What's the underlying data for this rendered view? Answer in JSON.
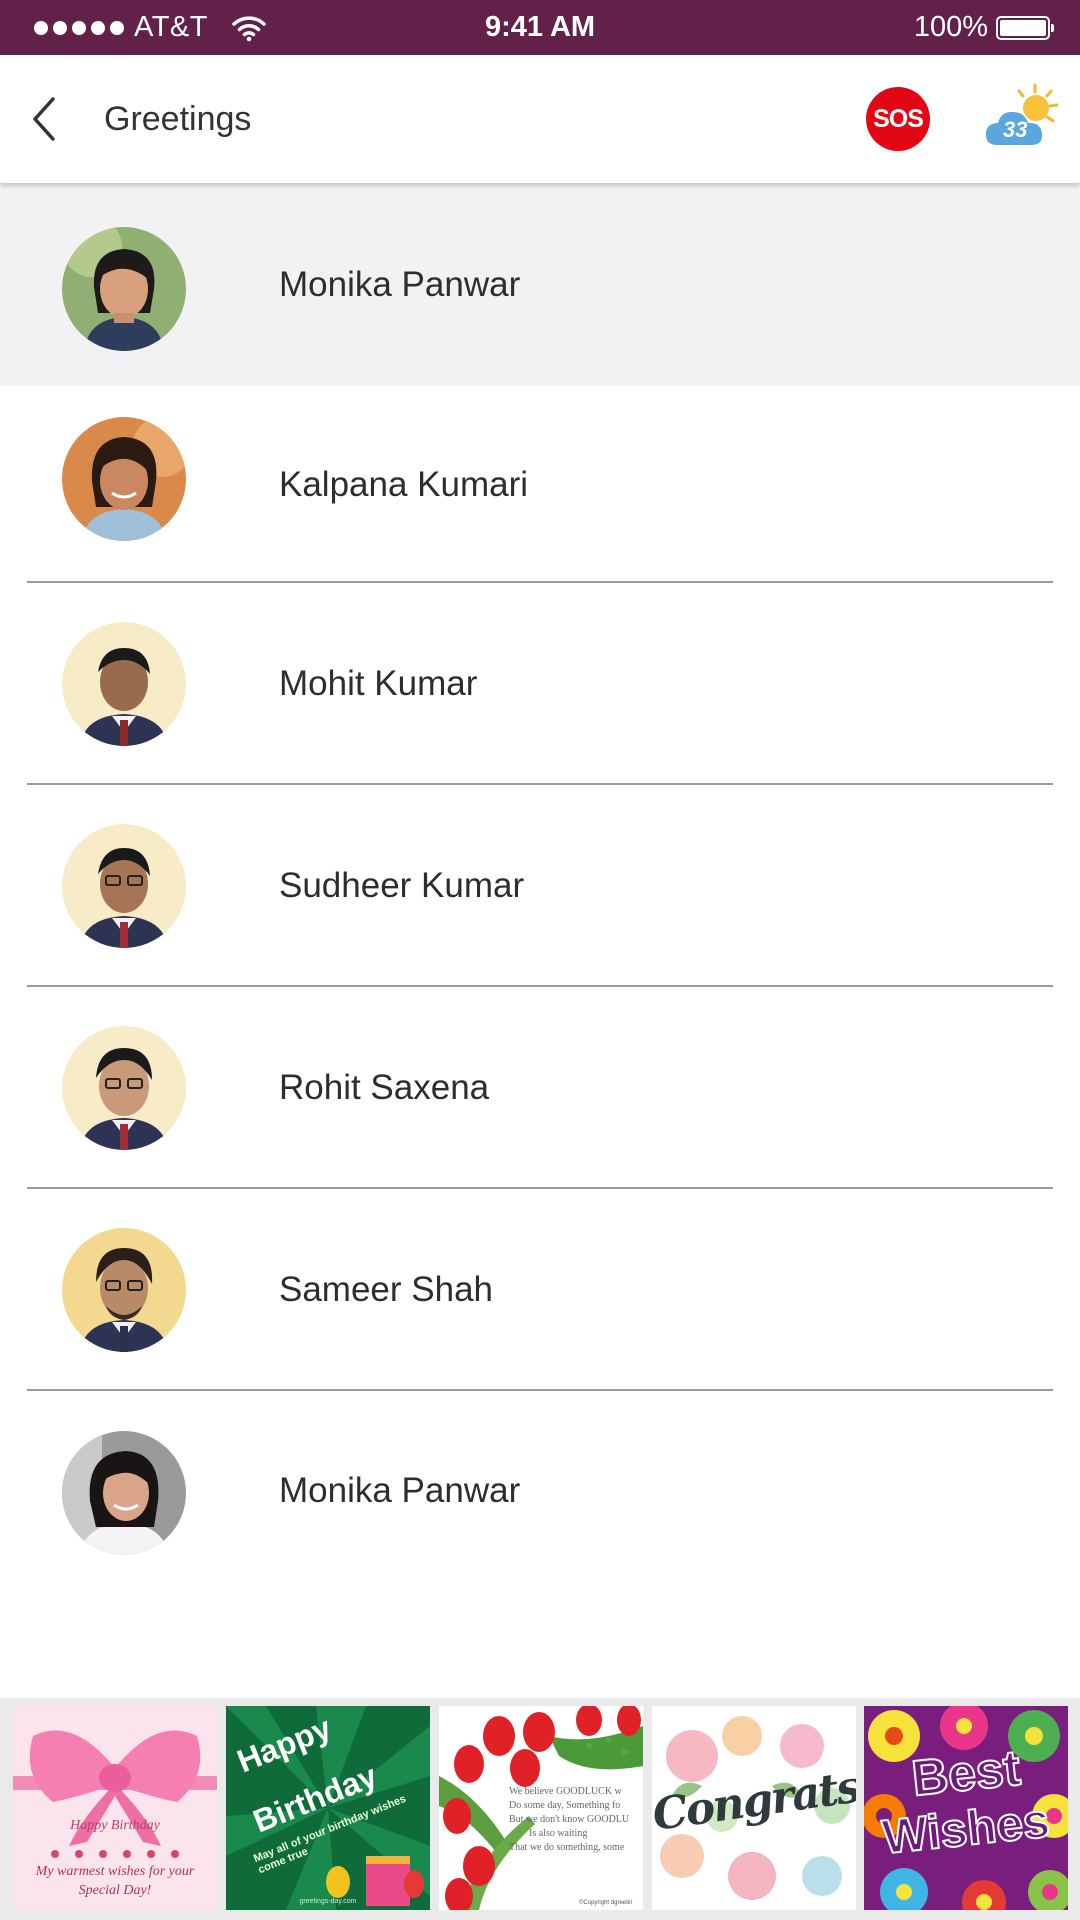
{
  "status_bar": {
    "carrier": "AT&T",
    "time": "9:41 AM",
    "battery": "100%"
  },
  "header": {
    "title": "Greetings",
    "sos_label": "SOS",
    "weather_temp": "33"
  },
  "contacts": [
    {
      "name": "Monika Panwar",
      "selected": true
    },
    {
      "name": "Kalpana Kumari"
    },
    {
      "name": "Mohit Kumar"
    },
    {
      "name": "Sudheer Kumar"
    },
    {
      "name": "Rohit Saxena"
    },
    {
      "name": "Sameer Shah"
    },
    {
      "name": "Monika Panwar"
    }
  ],
  "greeting_cards": [
    {
      "line1": "Happy Birthday",
      "line2": "My warmest wishes for your",
      "line3": "Special Day!"
    },
    {
      "line1": "Happy",
      "line2": "Birthday",
      "line3": "May all of your birthday wishes come true",
      "footer": "greetings-day.com"
    },
    {
      "line1": "We believe GOODLUCK w",
      "line2": "Do some day, Something fo",
      "line3": "But we don't know GOODLU",
      "line4": "Is also waiting",
      "line5": "That we do something, some",
      "footer": "©Copyright dgreetin"
    },
    {
      "line1": "Congrats"
    },
    {
      "line1": "Best",
      "line2": "Wishes"
    }
  ],
  "colors": {
    "status_bar": "#612149",
    "sos": "#e30613",
    "selected_row": "#f2f1f3"
  }
}
